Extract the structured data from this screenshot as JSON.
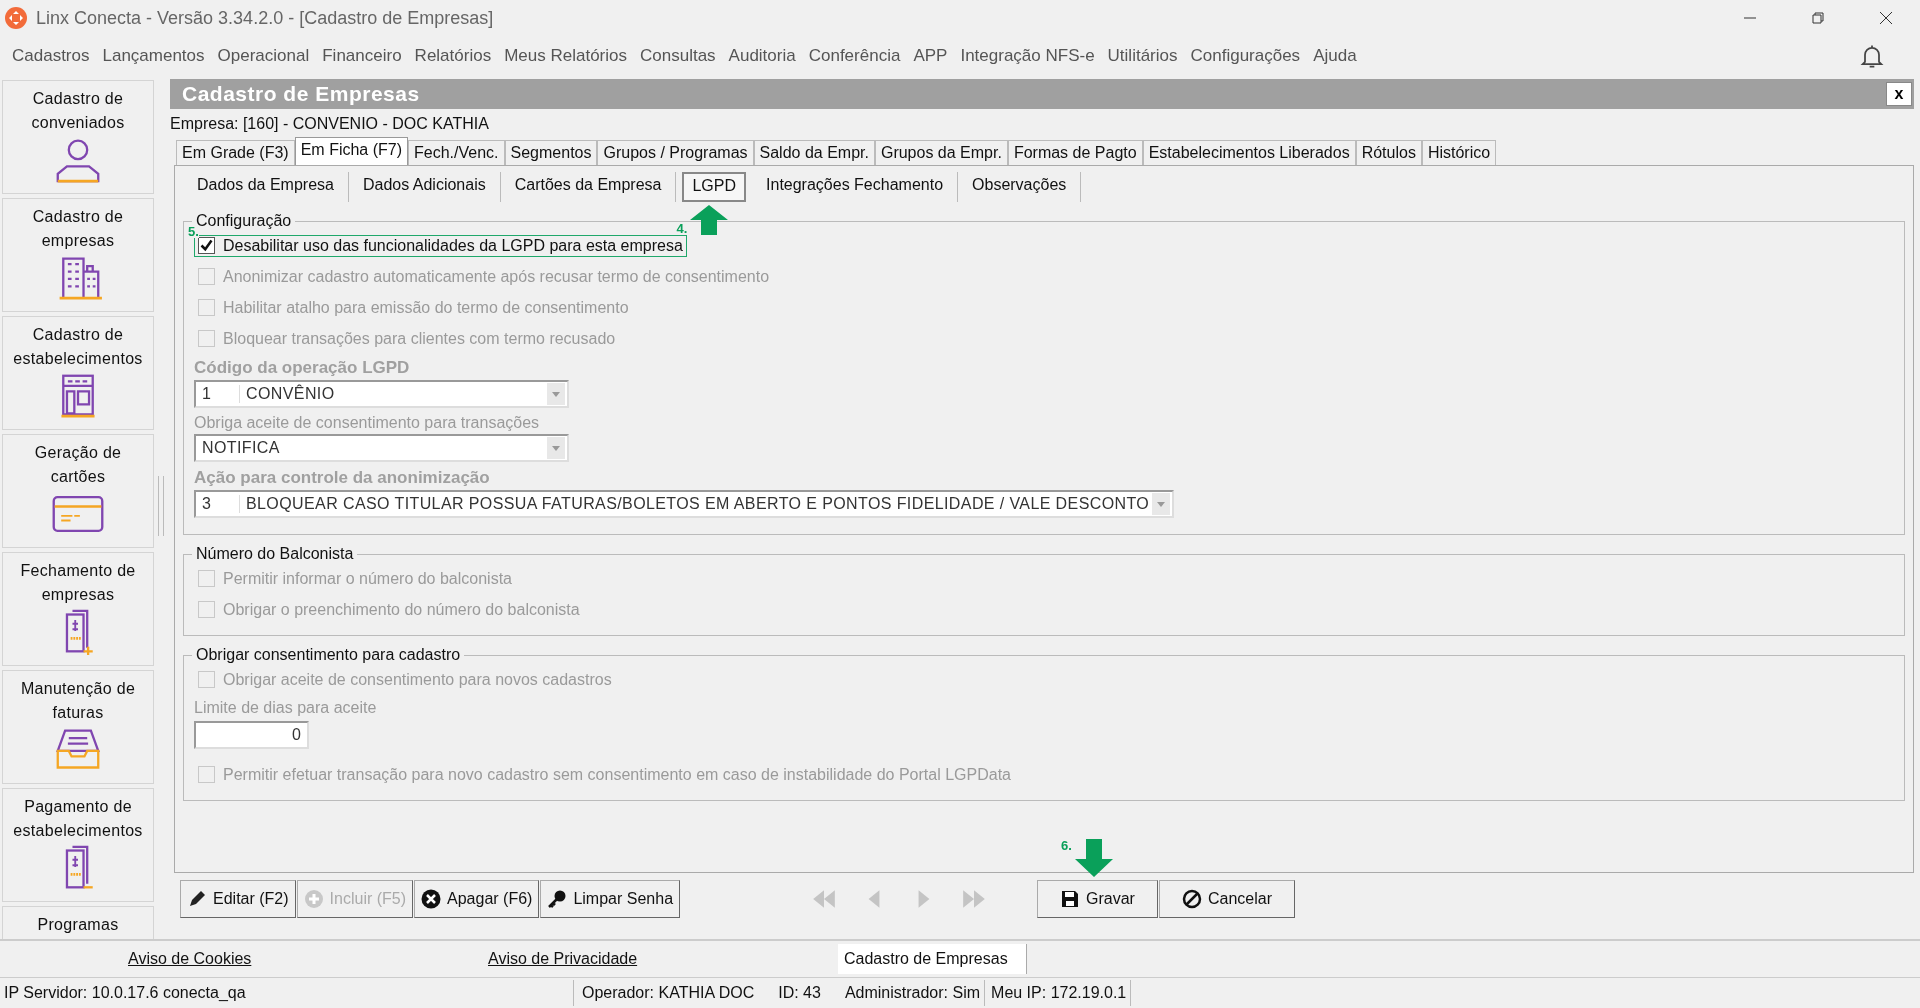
{
  "window": {
    "title": "Linx Conecta - Versão 3.34.2.0 - [Cadastro de Empresas]"
  },
  "menu": [
    "Cadastros",
    "Lançamentos",
    "Operacional",
    "Financeiro",
    "Relatórios",
    "Meus Relatórios",
    "Consultas",
    "Auditoria",
    "Conferência",
    "APP",
    "Integração NFS-e",
    "Utilitários",
    "Configurações",
    "Ajuda"
  ],
  "sidebar": {
    "items": [
      {
        "label": "Cadastro de conveniados",
        "kind": "person"
      },
      {
        "label": "Cadastro de empresas",
        "kind": "buildings"
      },
      {
        "label": "Cadastro de estabelecimentos",
        "kind": "store"
      },
      {
        "label": "Geração de cartões",
        "kind": "card"
      },
      {
        "label": "Fechamento de empresas",
        "kind": "invoice-plus"
      },
      {
        "label": "Manutenção de faturas",
        "kind": "tray"
      },
      {
        "label": "Pagamento de estabelecimentos",
        "kind": "invoice-minus"
      },
      {
        "label": "Programas",
        "kind": "none"
      }
    ]
  },
  "form": {
    "title": "Cadastro de Empresas",
    "close": "x",
    "empresa": "Empresa: [160] - CONVENIO -  DOC KATHIA",
    "tabs": [
      {
        "label": "Em Grade (F3)",
        "selected": false
      },
      {
        "label": "Em Ficha (F7)",
        "selected": true
      },
      {
        "label": "Fech./Venc.",
        "selected": false
      },
      {
        "label": "Segmentos",
        "selected": false
      },
      {
        "label": "Grupos / Programas",
        "selected": false
      },
      {
        "label": "Saldo da Empr.",
        "selected": false
      },
      {
        "label": "Grupos da Empr.",
        "selected": false
      },
      {
        "label": "Formas de Pagto",
        "selected": false
      },
      {
        "label": "Estabelecimentos Liberados",
        "selected": false
      },
      {
        "label": "Rótulos",
        "selected": false
      },
      {
        "label": "Histórico",
        "selected": false
      }
    ],
    "subtabs": [
      {
        "label": "Dados da Empresa",
        "selected": false
      },
      {
        "label": "Dados Adicionais",
        "selected": false
      },
      {
        "label": "Cartões da Empresa",
        "selected": false
      },
      {
        "label": "LGPD",
        "selected": true,
        "marker": "4."
      },
      {
        "label": "Integrações Fechamento",
        "selected": false
      },
      {
        "label": "Observações",
        "selected": false
      }
    ],
    "groups": [
      {
        "title": "Configuração",
        "items": [
          {
            "kind": "checkbox",
            "label": "Desabilitar uso das funcionalidades da LGPD para esta empresa",
            "checked": true,
            "disabled": false,
            "highlighted": true,
            "marker": "5."
          },
          {
            "kind": "checkbox",
            "label": "Anonimizar cadastro automaticamente após recusar termo de consentimento",
            "checked": false,
            "disabled": true,
            "highlighted": false
          },
          {
            "kind": "checkbox",
            "label": "Habilitar atalho para emissão do termo de consentimento",
            "checked": false,
            "disabled": true,
            "highlighted": false
          },
          {
            "kind": "checkbox",
            "label": "Bloquear transações para clientes com termo recusado",
            "checked": false,
            "disabled": true,
            "highlighted": false
          },
          {
            "kind": "combo",
            "label": "Código da operação LGPD",
            "strong": true,
            "code": "1",
            "value": "CONVÊNIO",
            "wide": false
          },
          {
            "kind": "combo",
            "label": "Obriga aceite de consentimento para transações",
            "strong": false,
            "value": "NOTIFICA",
            "wide": false
          },
          {
            "kind": "combo",
            "label": "Ação para controle da anonimização",
            "strong": true,
            "code": "3",
            "value": "BLOQUEAR CASO TITULAR POSSUA FATURAS/BOLETOS EM ABERTO E PONTOS FIDELIDADE / VALE DESCONTO",
            "wide": true
          }
        ]
      },
      {
        "title": "Número do Balconista",
        "items": [
          {
            "kind": "checkbox",
            "label": "Permitir informar o número do balconista",
            "checked": false,
            "disabled": true,
            "highlighted": false
          },
          {
            "kind": "checkbox",
            "label": "Obrigar o preenchimento do número do balconista",
            "checked": false,
            "disabled": true,
            "highlighted": false
          }
        ]
      },
      {
        "title": "Obrigar consentimento para cadastro",
        "items": [
          {
            "kind": "checkbox",
            "label": "Obrigar aceite de consentimento para novos cadastros",
            "checked": false,
            "disabled": true,
            "highlighted": false
          },
          {
            "kind": "number",
            "label": "Limite de dias para aceite",
            "value": "0"
          },
          {
            "kind": "checkbox",
            "label": "Permitir efetuar transação para novo cadastro sem consentimento em caso de instabilidade do Portal LGPData",
            "checked": false,
            "disabled": true,
            "highlighted": false
          }
        ]
      }
    ],
    "toolbar": [
      {
        "label": "Editar (F2)",
        "kind": "pencil",
        "disabled": false
      },
      {
        "label": "Incluir (F5)",
        "kind": "plus",
        "disabled": true
      },
      {
        "label": "Apagar (F6)",
        "kind": "delete",
        "disabled": false
      },
      {
        "label": "Limpar Senha",
        "kind": "key",
        "disabled": false
      }
    ],
    "navigation": [
      {
        "kind": "first",
        "disabled": true
      },
      {
        "kind": "prev",
        "disabled": true
      },
      {
        "kind": "next",
        "disabled": true
      },
      {
        "kind": "last",
        "disabled": true
      }
    ],
    "actions": [
      {
        "label": "Gravar",
        "kind": "save",
        "marker": "6."
      },
      {
        "label": "Cancelar",
        "kind": "cancel"
      }
    ]
  },
  "footer": {
    "links": [
      "Aviso de Cookies",
      "Aviso de Privacidade"
    ],
    "window_tab": "Cadastro de Empresas"
  },
  "status_bar": [
    "IP Servidor: 10.0.17.6 conecta_qa",
    "Operador: KATHIA DOC",
    "ID: 43",
    "Administrador: Sim",
    "Meu IP: 172.19.0.1"
  ]
}
